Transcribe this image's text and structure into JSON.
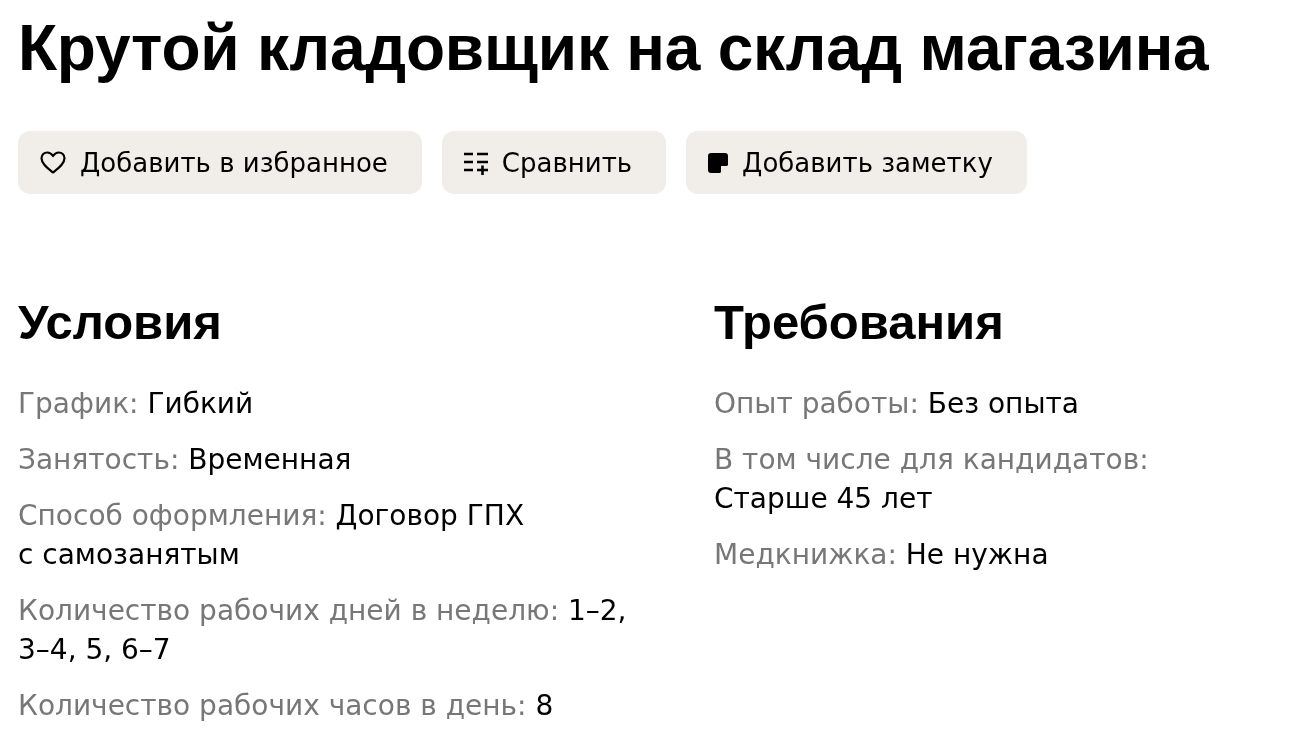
{
  "title": "Крутой кладовщик на склад магазина",
  "actions": [
    {
      "kind": "favorite",
      "label": "Добавить в избранное"
    },
    {
      "kind": "compare",
      "label": "Сравнить"
    },
    {
      "kind": "note",
      "label": "Добавить заметку"
    }
  ],
  "sections": [
    {
      "heading": "Условия",
      "items": [
        {
          "label": "График:",
          "value": "Гибкий"
        },
        {
          "label": "Занятость:",
          "value": "Временная"
        },
        {
          "label": "Способ оформления:",
          "value": "Договор ГПХ с самозанятым"
        },
        {
          "label": "Количество рабочих дней в неделю:",
          "value": "1–2, 3–4, 5, 6–7"
        },
        {
          "label": "Количество рабочих часов в день:",
          "value": "8"
        }
      ]
    },
    {
      "heading": "Требования",
      "items": [
        {
          "label": "Опыт работы:",
          "value": "Без опыта"
        },
        {
          "label": "В том числе для кандидатов:",
          "value": "Старше 45 лет"
        },
        {
          "label": "Медкнижка:",
          "value": "Не нужна"
        }
      ]
    }
  ]
}
